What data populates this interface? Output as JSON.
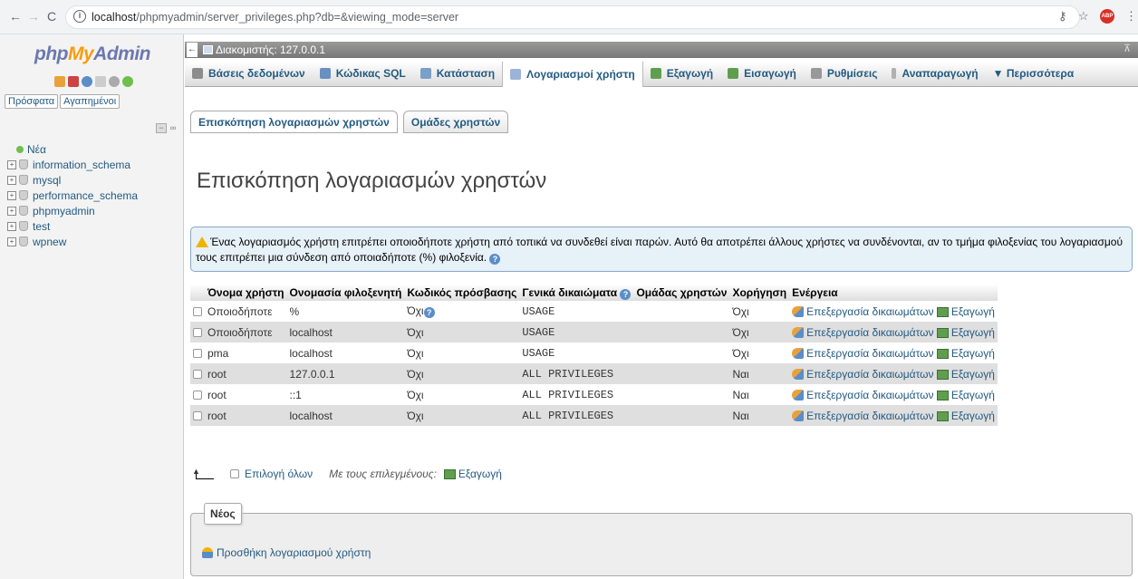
{
  "browser": {
    "url_host": "localhost",
    "url_path": "/phpmyadmin/server_privileges.php?db=&viewing_mode=server",
    "adblock_label": "ABP"
  },
  "sidebar": {
    "logo_php": "php",
    "logo_my": "My",
    "logo_admin": "Admin",
    "tab_recent": "Πρόσφατα",
    "tab_favorites": "Αγαπημένοι",
    "new_label": "Νέα",
    "databases": [
      "information_schema",
      "mysql",
      "performance_schema",
      "phpmyadmin",
      "test",
      "wpnew"
    ]
  },
  "serverbar": {
    "label": "Διακομιστής: 127.0.0.1"
  },
  "topmenu": {
    "items": [
      {
        "label": "Βάσεις δεδομένων",
        "icon": "database-icon",
        "color": "#8c8c8c"
      },
      {
        "label": "Κώδικας SQL",
        "icon": "sql-icon",
        "color": "#6a8fc0"
      },
      {
        "label": "Κατάσταση",
        "icon": "status-icon",
        "color": "#7aa0c8"
      },
      {
        "label": "Λογαριασμοί χρήστη",
        "icon": "users-icon",
        "color": "#9bb3d6"
      },
      {
        "label": "Εξαγωγή",
        "icon": "export-icon",
        "color": "#5f9e4f"
      },
      {
        "label": "Εισαγωγή",
        "icon": "import-icon",
        "color": "#5f9e4f"
      },
      {
        "label": "Ρυθμίσεις",
        "icon": "wrench-icon",
        "color": "#999999"
      },
      {
        "label": "Αναπαραγωγή",
        "icon": "replication-icon",
        "color": "#b0b0b0"
      },
      {
        "label": "▼ Περισσότερα",
        "icon": "",
        "color": ""
      }
    ]
  },
  "subtabs": {
    "overview": "Επισκόπηση λογαριασμών χρηστών",
    "groups": "Ομάδες χρηστών"
  },
  "page_title": "Επισκόπηση λογαριασμών χρηστών",
  "notice": {
    "text": "Ένας λογαριασμός χρήστη επιτρέπει οποιοδήποτε χρήστη από τοπικά να συνδεθεί είναι παρών. Αυτό θα αποτρέπει άλλους χρήστες να συνδένονται, αν το τμήμα φιλοξενίας του λογαριασμού τους επιτρέπει μια σύνδεση από οποιαδήποτε (%) φιλοξενία."
  },
  "users_table": {
    "headers": [
      "Όνομα χρήστη",
      "Ονομασία φιλοξενητή",
      "Κωδικός πρόσβασης",
      "Γενικά δικαιώματα",
      "Ομάδας χρηστών",
      "Χορήγηση",
      "Ενέργεια"
    ],
    "rows": [
      {
        "user": "Οποιοδήποτε",
        "host": "%",
        "password": "Όχι",
        "privileges": "USAGE",
        "group": "",
        "grant": "Όχι",
        "edit": "Επεξεργασία δικαιωμάτων",
        "export": "Εξαγωγή"
      },
      {
        "user": "Οποιοδήποτε",
        "host": "localhost",
        "password": "Όχι",
        "privileges": "USAGE",
        "group": "",
        "grant": "Όχι",
        "edit": "Επεξεργασία δικαιωμάτων",
        "export": "Εξαγωγή"
      },
      {
        "user": "pma",
        "host": "localhost",
        "password": "Όχι",
        "privileges": "USAGE",
        "group": "",
        "grant": "Όχι",
        "edit": "Επεξεργασία δικαιωμάτων",
        "export": "Εξαγωγή"
      },
      {
        "user": "root",
        "host": "127.0.0.1",
        "password": "Όχι",
        "privileges": "ALL PRIVILEGES",
        "group": "",
        "grant": "Ναι",
        "edit": "Επεξεργασία δικαιωμάτων",
        "export": "Εξαγωγή"
      },
      {
        "user": "root",
        "host": "::1",
        "password": "Όχι",
        "privileges": "ALL PRIVILEGES",
        "group": "",
        "grant": "Ναι",
        "edit": "Επεξεργασία δικαιωμάτων",
        "export": "Εξαγωγή"
      },
      {
        "user": "root",
        "host": "localhost",
        "password": "Όχι",
        "privileges": "ALL PRIVILEGES",
        "group": "",
        "grant": "Ναι",
        "edit": "Επεξεργασία δικαιωμάτων",
        "export": "Εξαγωγή"
      }
    ]
  },
  "bulk": {
    "check_all": "Επιλογή όλων",
    "with_selected": "Με τους επιλεγμένους:",
    "export": "Εξαγωγή"
  },
  "new_section": {
    "legend": "Νέος",
    "add_user": "Προσθήκη λογαριασμού χρήστη"
  }
}
